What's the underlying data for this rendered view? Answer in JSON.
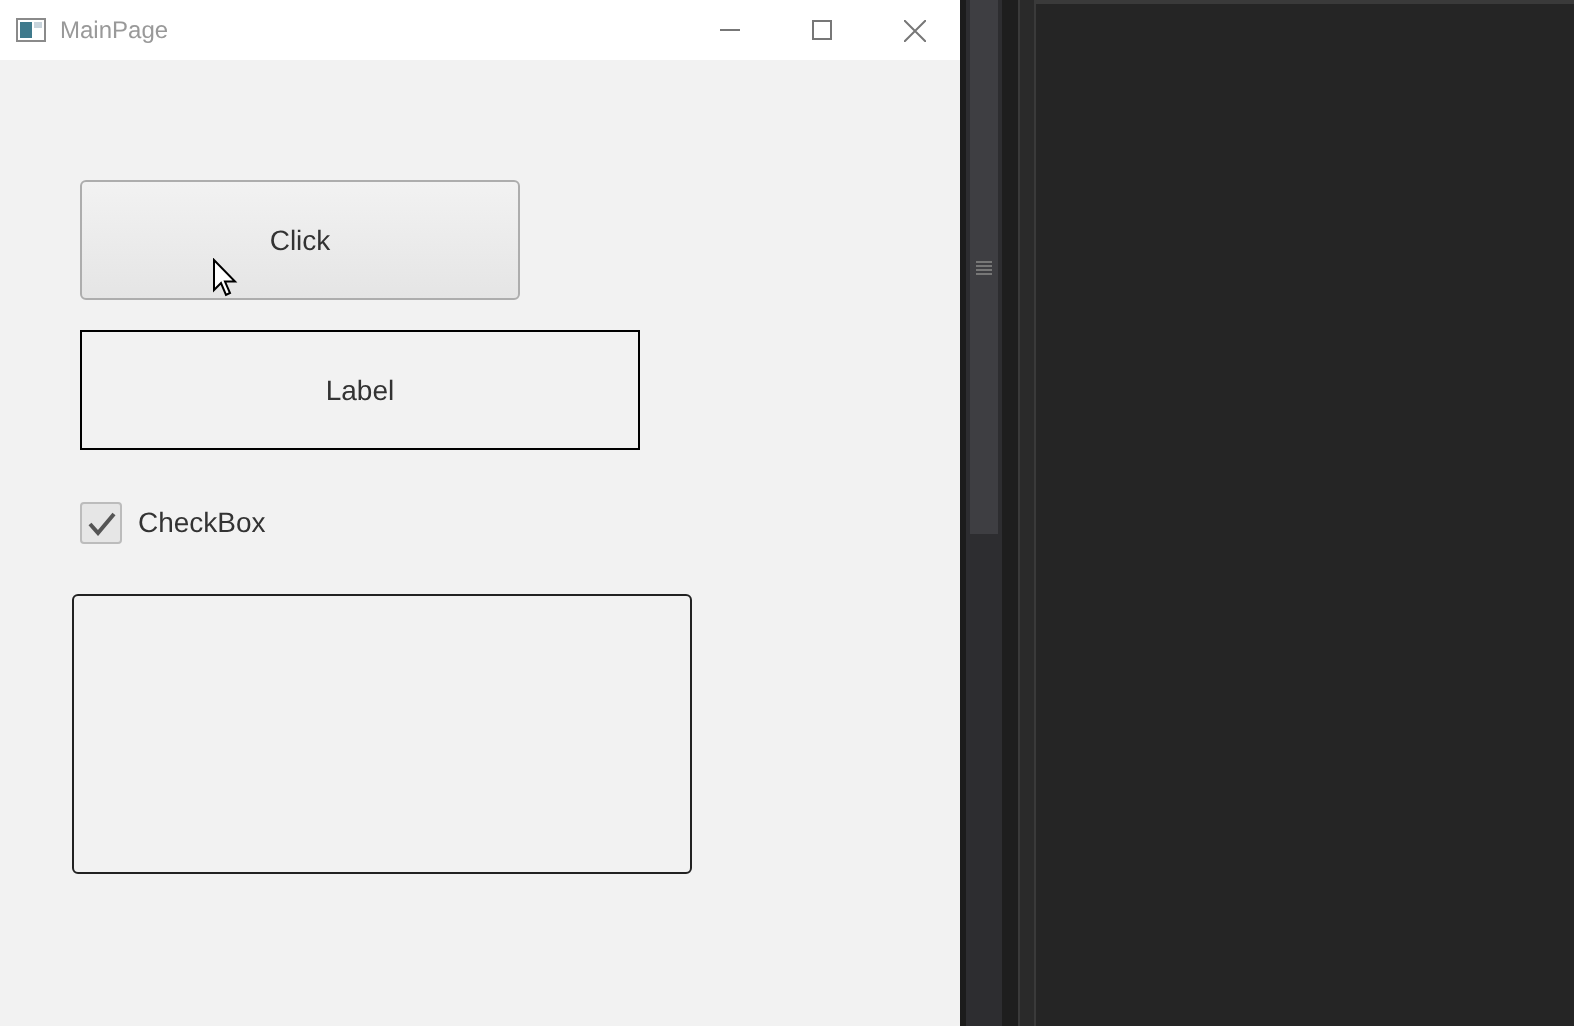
{
  "window": {
    "title": "MainPage"
  },
  "button": {
    "label": "Click"
  },
  "label": {
    "text": "Label"
  },
  "checkbox": {
    "label": "CheckBox",
    "checked": true
  }
}
